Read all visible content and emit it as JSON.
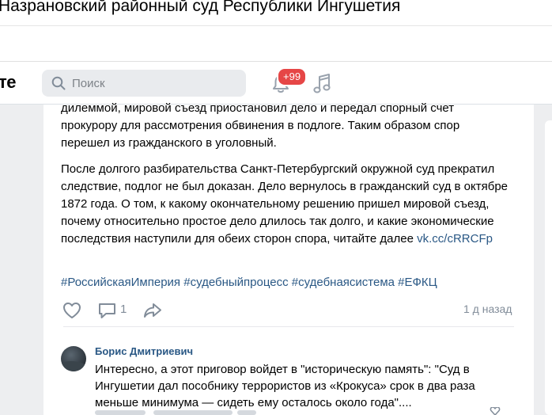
{
  "browser": {
    "page_title": "Назрановский районный суд Республики Ингушетия"
  },
  "header": {
    "logo_text": "те",
    "search": {
      "placeholder": "Поиск",
      "value": ""
    },
    "notifications_badge": "+99"
  },
  "post": {
    "paragraph1": "дилеммой, мировой съезд приостановил дело и передал спорный счет прокурору для рассмотрения обвинения в подлоге. Таким образом спор перешел из гражданского в уголовный.",
    "paragraph2": "После долгого разбирательства Санкт-Петербургский окружной суд прекратил следствие, подлог не был доказан. Дело вернулось в гражданский суд в октябре 1872 года. О том, к какому окончательному решению пришел мировой съезд, почему относительно простое дело длилось так долго, и какие экономические последствия наступили для обеих сторон спора, читайте далее",
    "link": "vk.cc/cRRCFp",
    "hashtags": [
      "#РоссийскаяИмперия",
      "#судебныйпроцесс",
      "#судебнаясистема",
      "#ЕФКЦ"
    ],
    "comment_count": "1",
    "time_ago": "1 д назад"
  },
  "comment": {
    "author": "Борис Дмитриевич",
    "text": "Интересно, а этот приговор войдет в \"историческую память\": \"Суд в Ингушетии дал пособнику террористов из «Крокуса» срок в два раза меньше минимума — сидеть ему осталось около года\"...."
  },
  "colors": {
    "accent_link": "#2a5885",
    "badge": "#e64646",
    "icon_gray": "#818c99",
    "page_bg": "#edeef0"
  }
}
